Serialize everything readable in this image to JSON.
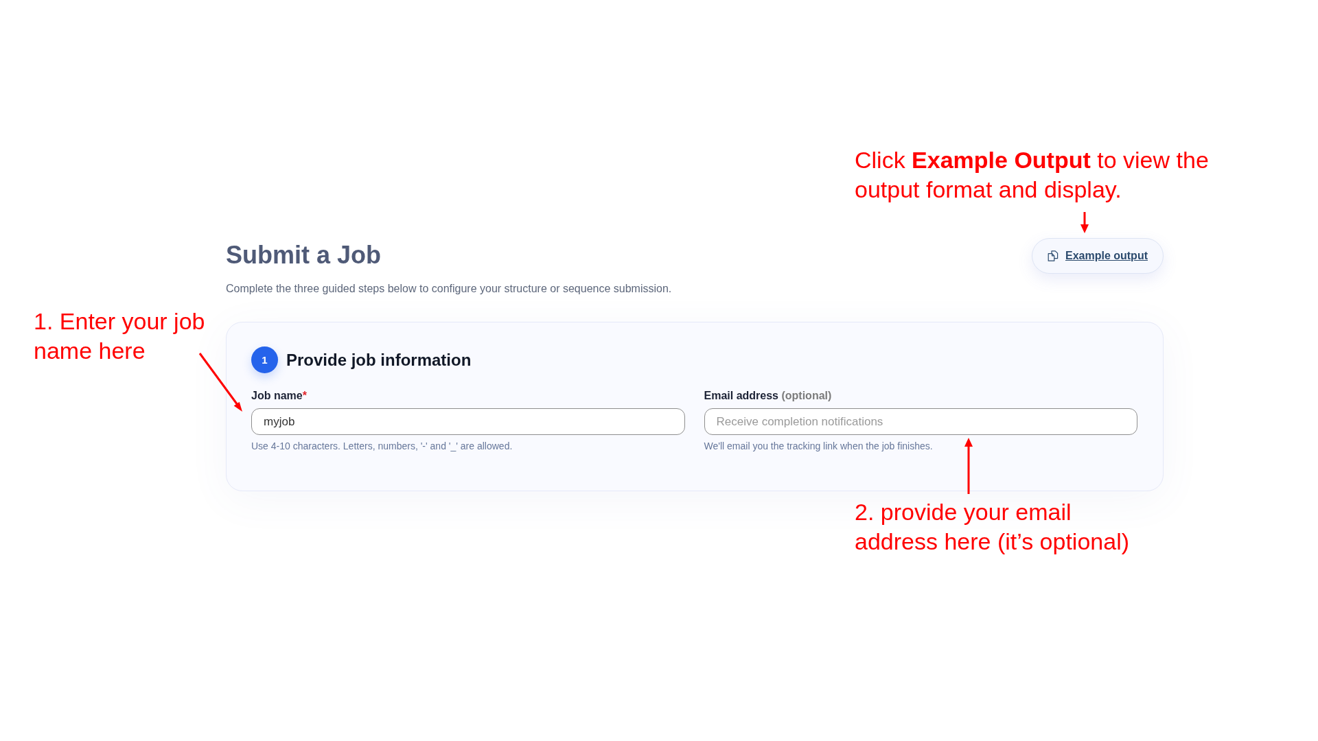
{
  "page": {
    "title": "Submit a Job",
    "subtitle": "Complete the three guided steps below to configure your structure or sequence submission.",
    "example_button": {
      "label": "Example output"
    }
  },
  "steps": [
    {
      "number": "1",
      "title": "Provide job information",
      "fields": [
        {
          "label": "Job name",
          "required_mark": "*",
          "value": "myjob",
          "hint": "Use 4-10 characters. Letters, numbers, '-' and '_' are allowed."
        },
        {
          "label": "Email address",
          "note": "(optional)",
          "placeholder": "Receive completion notifications",
          "hint": "We'll email you the tracking link when the job finishes."
        }
      ]
    }
  ],
  "annotations": [
    {
      "text": "Click **Example Output** to view the output format and display."
    },
    {
      "text": "1. Enter your job name here"
    },
    {
      "text": "2. provide your email address here (it’s optional)"
    }
  ]
}
